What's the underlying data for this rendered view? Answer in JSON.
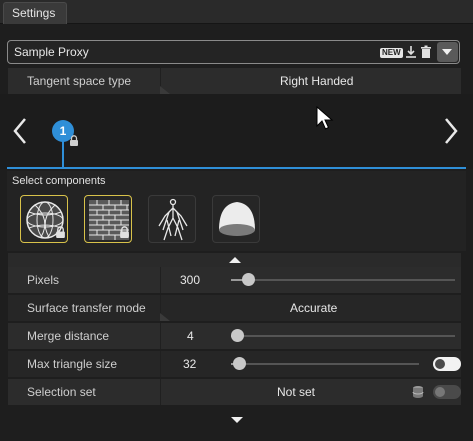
{
  "tabs": [
    {
      "label": "Settings"
    }
  ],
  "proxy": {
    "name": "Sample Proxy",
    "new_badge": "NEW"
  },
  "tangent_space": {
    "label": "Tangent space type",
    "value": "Right Handed"
  },
  "viewer": {
    "marker_number": "1"
  },
  "components": {
    "title": "Select components",
    "items": [
      {
        "icon": "sphere-wireframe-icon",
        "selected": true,
        "locked": true
      },
      {
        "icon": "brick-texture-icon",
        "selected": true,
        "locked": true
      },
      {
        "icon": "skeleton-icon",
        "selected": false,
        "locked": false
      },
      {
        "icon": "dome-shape-icon",
        "selected": false,
        "locked": false
      }
    ]
  },
  "settings": {
    "pixels": {
      "label": "Pixels",
      "value": "300"
    },
    "surface_transfer": {
      "label": "Surface transfer mode",
      "value": "Accurate"
    },
    "merge_distance": {
      "label": "Merge distance",
      "value": "4"
    },
    "max_triangle": {
      "label": "Max triangle size",
      "value": "32"
    },
    "selection_set": {
      "label": "Selection set",
      "value": "Not set"
    }
  },
  "colors": {
    "accent": "#2f8fd8",
    "selected_border": "#d8c24a"
  }
}
